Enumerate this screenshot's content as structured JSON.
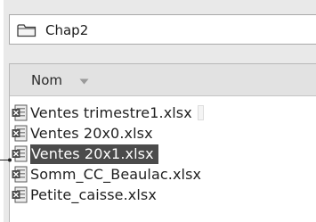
{
  "path": {
    "folder_name": "Chap2",
    "icon": "folder-icon"
  },
  "file_list": {
    "column_header": "Nom",
    "sort_icon": "sort-descending-icon",
    "file_icon": "excel-file-icon",
    "files": [
      {
        "name": "Ventes trimestre1.xlsx",
        "selected": false
      },
      {
        "name": "Ventes 20x0.xlsx",
        "selected": false
      },
      {
        "name": "Ventes 20x1.xlsx",
        "selected": true
      },
      {
        "name": "Somm_CC_Beaulac.xlsx",
        "selected": false
      },
      {
        "name": "Petite_caisse.xlsx",
        "selected": false
      }
    ]
  },
  "colors": {
    "selection": "#4b4b4b",
    "background": "#e9e9e9"
  }
}
